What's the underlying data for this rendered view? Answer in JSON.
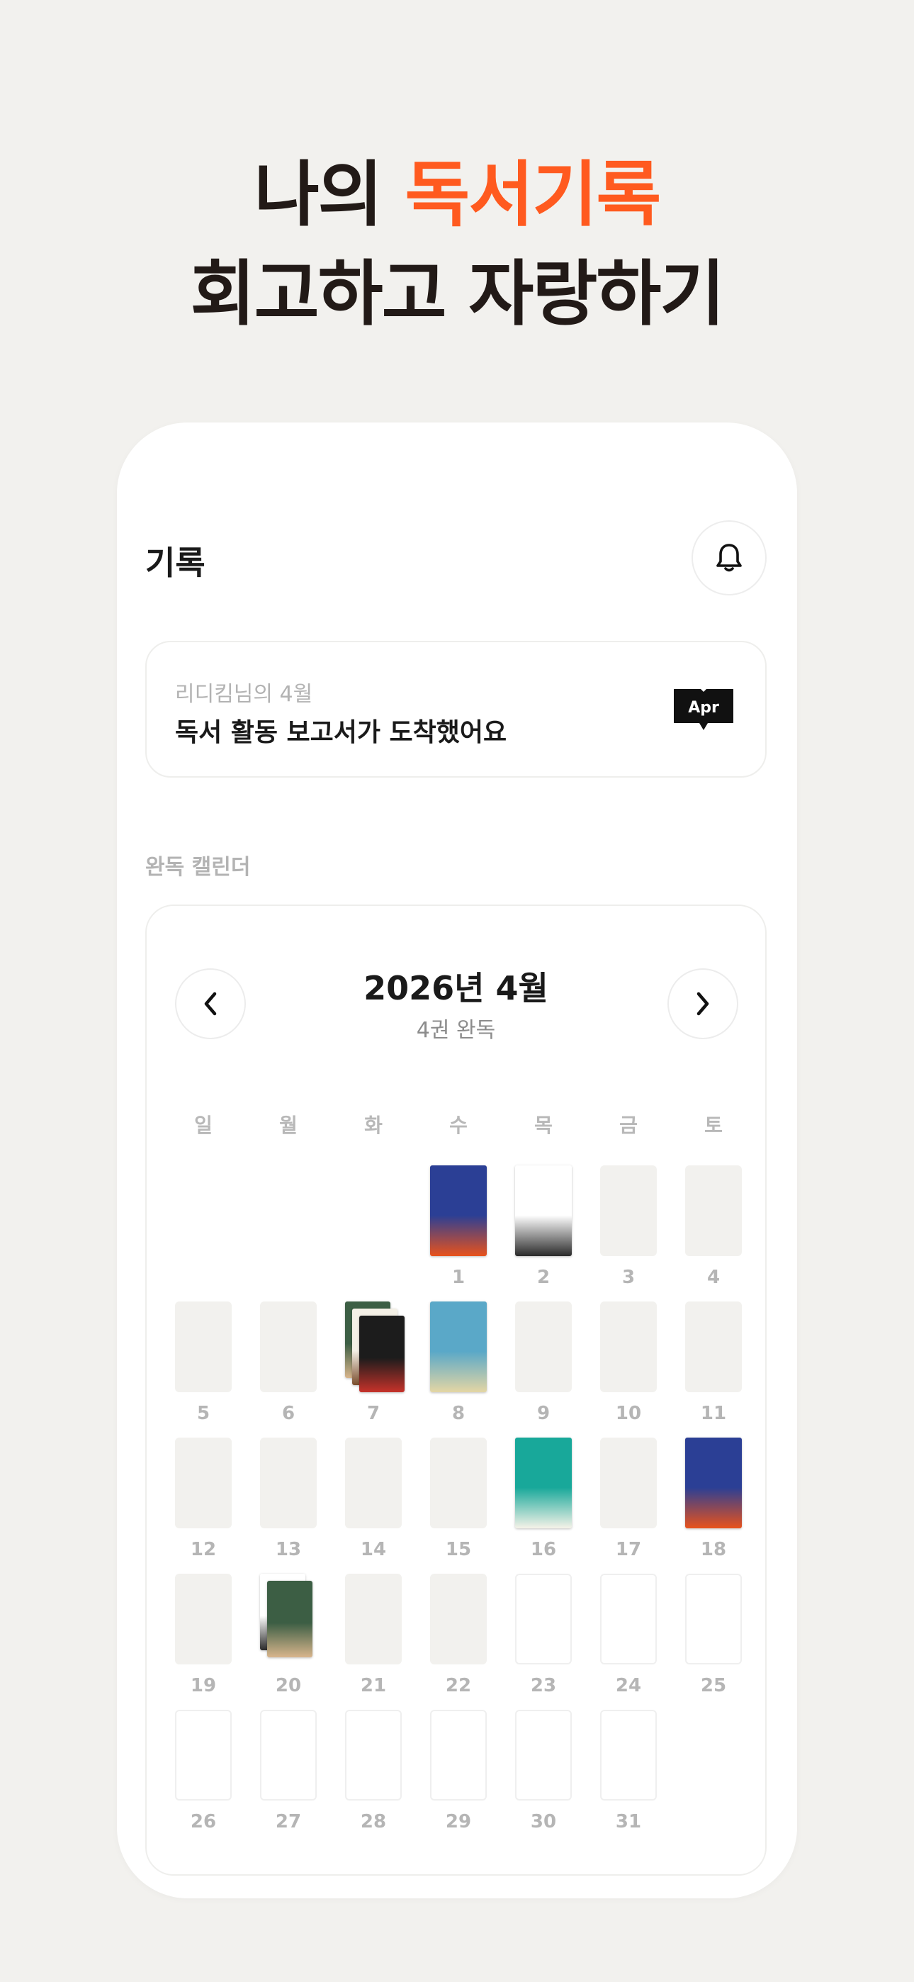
{
  "hero": {
    "line1_plain": "나의 ",
    "line1_accent": "독서기록",
    "line2": "회고하고 자랑하기",
    "accent_color": "#ff5a1f"
  },
  "header": {
    "title": "기록",
    "bell_icon": "bell-icon"
  },
  "report": {
    "subtitle": "리디킴님의 4월",
    "message": "독서 활동 보고서가 도착했어요",
    "badge_text": "Apr"
  },
  "calendar": {
    "section_label": "완독 캘린더",
    "month_title": "2026년 4월",
    "summary": "4권 완독",
    "prev_icon": "chevron-left-icon",
    "next_icon": "chevron-right-icon",
    "weekdays": [
      "일",
      "월",
      "화",
      "수",
      "목",
      "금",
      "토"
    ],
    "days": [
      {
        "num": "1",
        "books": 1
      },
      {
        "num": "2",
        "books": 1
      },
      {
        "num": "3",
        "books": 0
      },
      {
        "num": "4",
        "books": 0
      },
      {
        "num": "5",
        "books": 0
      },
      {
        "num": "6",
        "books": 0
      },
      {
        "num": "7",
        "books": 3
      },
      {
        "num": "8",
        "books": 1
      },
      {
        "num": "9",
        "books": 0
      },
      {
        "num": "10",
        "books": 0
      },
      {
        "num": "11",
        "books": 0
      },
      {
        "num": "12",
        "books": 0
      },
      {
        "num": "13",
        "books": 0
      },
      {
        "num": "14",
        "books": 0
      },
      {
        "num": "15",
        "books": 0
      },
      {
        "num": "16",
        "books": 1
      },
      {
        "num": "17",
        "books": 0
      },
      {
        "num": "18",
        "books": 1
      },
      {
        "num": "19",
        "books": 0
      },
      {
        "num": "20",
        "books": 2
      },
      {
        "num": "21",
        "books": 0
      },
      {
        "num": "22",
        "books": 0
      },
      {
        "num": "23",
        "books": 0
      },
      {
        "num": "24",
        "books": 0
      },
      {
        "num": "25",
        "books": 0
      },
      {
        "num": "26",
        "books": 0
      },
      {
        "num": "27",
        "books": 0
      },
      {
        "num": "28",
        "books": 0
      },
      {
        "num": "29",
        "books": 0
      },
      {
        "num": "30",
        "books": 0
      },
      {
        "num": "31",
        "books": 0
      }
    ]
  }
}
